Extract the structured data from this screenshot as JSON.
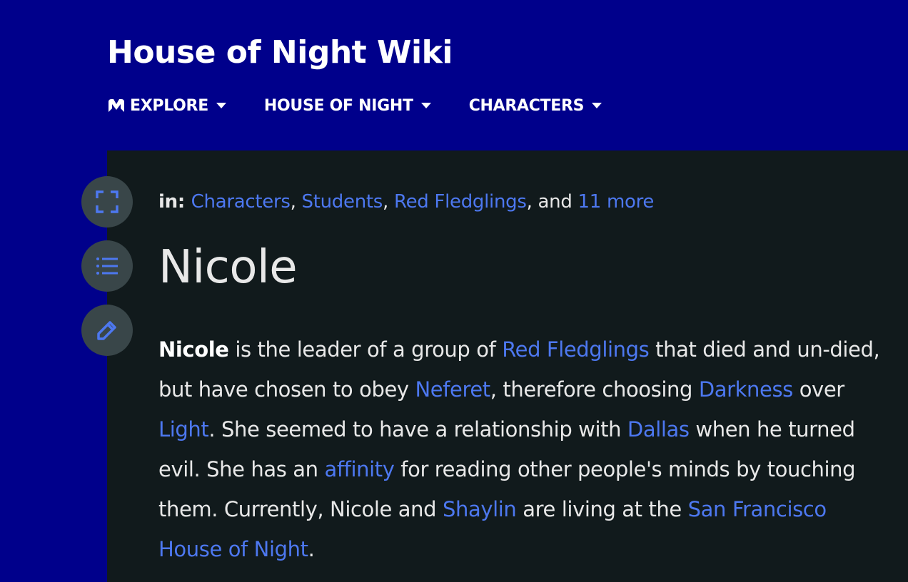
{
  "header": {
    "wiki_title": "House of Night Wiki",
    "nav": [
      {
        "label": "EXPLORE",
        "icon": "fandom-icon"
      },
      {
        "label": "HOUSE OF NIGHT",
        "icon": "chevron-down-icon"
      },
      {
        "label": "CHARACTERS",
        "icon": "chevron-down-icon"
      }
    ]
  },
  "tools": [
    {
      "icon": "fullscreen-icon"
    },
    {
      "icon": "table-of-contents-icon"
    },
    {
      "icon": "edit-pencil-icon"
    }
  ],
  "categories": {
    "prefix": "in:",
    "items": [
      "Characters",
      "Students",
      "Red Fledglings"
    ],
    "sep": ",",
    "and": "and",
    "more": "11 more"
  },
  "article": {
    "title": "Nicole",
    "p": {
      "t1": "Nicole",
      "t2": " is the leader of a group of ",
      "l1": "Red Fledglings",
      "t3": " that died and un-died, but have chosen to obey ",
      "l2": "Neferet",
      "t4": ", therefore choosing ",
      "l3": "Darkness",
      "t5": " over ",
      "l4": "Light",
      "t6": ". She seemed to have a relationship with ",
      "l5": "Dallas",
      "t7": " when he turned evil.  She has an ",
      "l6": "affinity",
      "t8": " for reading other people's minds by touching them. Currently, Nicole and ",
      "l7": "Shaylin",
      "t9": " are living at the ",
      "l8": "San Francisco House of Night",
      "t10": "."
    }
  },
  "colors": {
    "header_bg": "#00008b",
    "content_bg": "#111a1c",
    "link": "#4d78f0",
    "text": "#e8e8e8",
    "tool_bg": "#394649"
  }
}
